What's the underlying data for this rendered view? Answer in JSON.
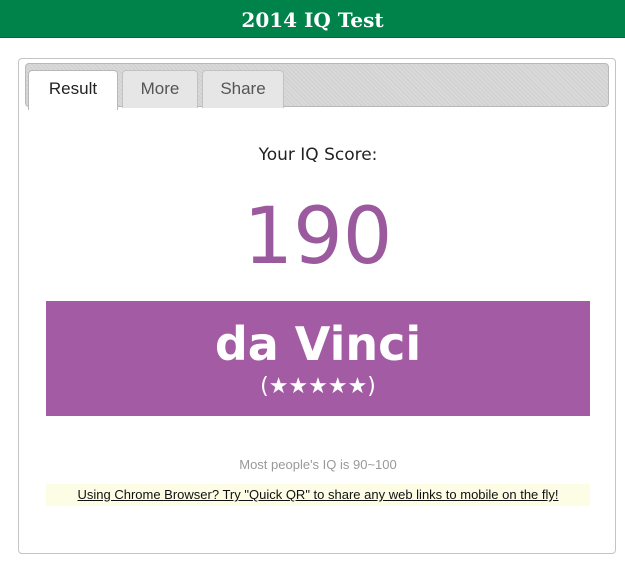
{
  "header": {
    "title": "2014 IQ Test"
  },
  "tabs": [
    {
      "label": "Result",
      "active": true
    },
    {
      "label": "More",
      "active": false
    },
    {
      "label": "Share",
      "active": false
    }
  ],
  "result": {
    "caption": "Your IQ Score:",
    "score": "190",
    "rank_name": "da Vinci",
    "rank_stars": "(★★★★★)",
    "stars": 5
  },
  "note": "Most people's IQ is 90~100",
  "promo": {
    "text": "Using Chrome Browser? Try \"Quick QR\" to share any web links to mobile on the fly!"
  },
  "colors": {
    "header_bg": "#00834a",
    "score_color": "#9b5a9e",
    "banner_bg": "#a35ca4"
  }
}
